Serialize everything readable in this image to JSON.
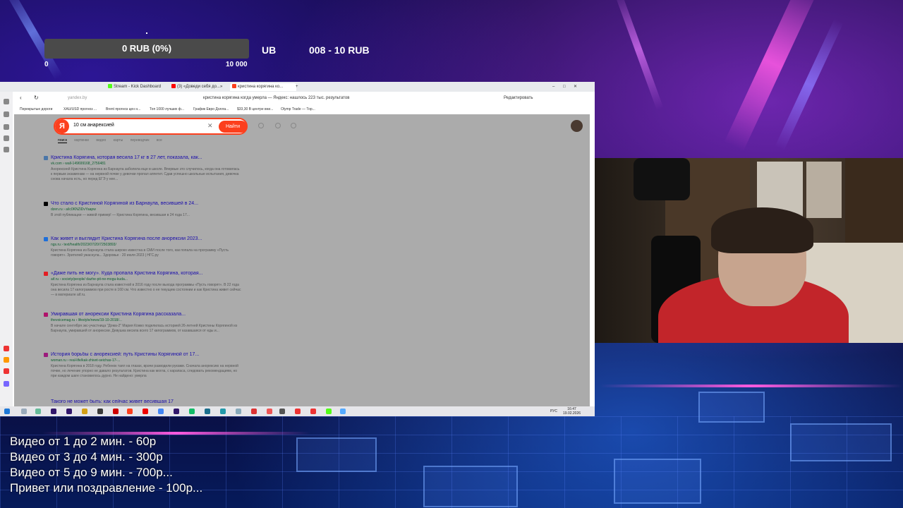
{
  "overlay": {
    "donation_bar_label": "0 RUB (0%)",
    "donation_progress": 0,
    "donation_min": "0",
    "donation_max": "10 000",
    "partial_label": "UB",
    "goal_label": "008 - 10 RUB"
  },
  "browser": {
    "tabs": [
      {
        "label": "Stream - Kick Dashboard"
      },
      {
        "label": "(3) «Доведи себя до...»"
      },
      {
        "label": "кристина корягина ко..."
      }
    ],
    "url": "yandex.by",
    "page_title": "кристина корягина когда умерла — Яндекс: нашлось 223 тыс. результатов",
    "edit_label": "Редактировать",
    "bookmarks": [
      "Перекрытые дороги",
      "XAU/USD прогноз ...",
      "Brent прогноз цен н...",
      "Топ 1000 лучших ф...",
      "График Евро Долла...",
      "$33,30 В центре вни...",
      "Olymp Trade — Тор..."
    ]
  },
  "yandex": {
    "logo": "Я",
    "query": "10 см анарексией",
    "search_button": "Найти",
    "nav_tabs": [
      "поиск",
      "картинки",
      "видео",
      "карты",
      "переводчик",
      "все"
    ],
    "results": [
      {
        "title": "Кристина Корягина, которая весила 17 кг в 27 лет, показала, как...",
        "url": "vk.com › wall-149699168_2756481",
        "snippet": "Анорексией Кристина Корягина из Барнаула заболела еще в школе. Впервые это случилось, когда она готовилась к первым экзаменам — на нервной почве у девочки пропал аппетит. Сдав успешно школьные испытания, девочка снова начала есть, но перед ЕГЭ у нее..."
      },
      {
        "title": "Что стало с Кристиной Корягиной из Барнаула, весившей в 24...",
        "url": "dzen.ru › a/ic0KNZiDvYaapw",
        "snippet": "В этой публикации — живой пример! — Кристина Корягина, весившая в 24 года 17..."
      },
      {
        "title": "Как живет и выглядит Кристина Корягина после анорексии 2023...",
        "url": "ngs.ru › text/health/2023/07/20/72503893/",
        "snippet": "Кристина Корягина из Барнаула стала широко известна в СМИ после того, как попала на программу «Пусть говорят». Зрителей ужаснула... Здоровье · 20 июля 2023 | НГС.ру"
      },
      {
        "title": "«Даже пить не могу». Куда пропала Кристина Корягина, которая...",
        "url": "aif.ru › society/people/ dazhe-pit-ne-mogu-kuda...",
        "snippet": "Кристина Корягина из Барнаула стала известной в 2016 году после выхода программы «Пусть говорят». В 22 года она весила 17 килограммов при росте в 160 см. Что известно о ее текущем состоянии и как Кристина живет сейчас — в материале aif.ru."
      },
      {
        "title": "Умиравшая от анорексии Кристина Корягина рассказала...",
        "url": "thevoicemag.ru › lifestyle/news/19-10-2018/...",
        "snippet": "В начале сентября экс-участница \"Дома-2\" Мария Кожко поделилась историей 26-летней Кристины Корягиной из Барнаула, умиравшей от анорексии. Девушка весила всего 17 килограммов, от казавшаяся от еды и..."
      },
      {
        "title": "История борьбы с анорексией: путь Кристины Корягиной от 17...",
        "url": "woman.ru › real-life/kak-zhivet-seichas-17-...",
        "snippet": "Кристина Корягина в 2018 году. Ребенок таял на глазах, врачи разводили руками. Сначала анорексию на нервной почве, но лечение упорно не давало результатов. Кристина как могла, с карапаса, следовать рекомендациям, но при каждом шаге становилось дурно. Не найдено: умерла"
      },
      {
        "title": "Такого не может быть: как сейчас живет весившая 17",
        "url": "",
        "snippet": ""
      }
    ]
  },
  "taskbar": {
    "lang": "РУС",
    "time": "16:47",
    "date": "19.02.2026"
  },
  "price_list": [
    "Видео от 1 до 2 мин. - 60р",
    "Видео от 3 до 4 мин. - 300р",
    "Видео от 5 до 9 мин. - 700р...",
    "Привет или поздравление - 100р..."
  ],
  "colors": {
    "yandex_red": "#fc3f1d",
    "progress_bar": "#4a4a4a",
    "link": "#1a0dab"
  }
}
